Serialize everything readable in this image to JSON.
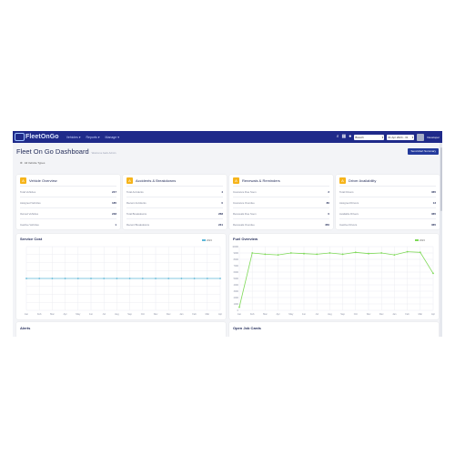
{
  "navbar": {
    "logo_text": "FleetOnGo",
    "menu": [
      {
        "label": "Vehicles"
      },
      {
        "label": "Reports"
      },
      {
        "label": "Manage"
      }
    ],
    "branch_select": "Branch",
    "period_select": "01 Apr 2024 - 31",
    "user_name": "Developer"
  },
  "page": {
    "title": "Fleet On Go Dashboard",
    "subtitle": "Welcome back Admin",
    "primary_button": "Send Alert Summary",
    "filter_label": "All Vehicle Types"
  },
  "cards": [
    {
      "icon": "A",
      "title": "Vehicle Overview",
      "rows": [
        {
          "label": "Total Vehicles",
          "value": "247"
        },
        {
          "label": "Assigned Vehicles",
          "value": "185"
        },
        {
          "label": "Owned Vehicles",
          "value": "248"
        },
        {
          "label": "Inactive Vehicles",
          "value": "1"
        }
      ]
    },
    {
      "icon": "A",
      "title": "Accidents & Breakdowns",
      "rows": [
        {
          "label": "Total Accidents",
          "value": "4"
        },
        {
          "label": "Recent Accidents",
          "value": "0"
        },
        {
          "label": "Total Breakdowns",
          "value": "268"
        },
        {
          "label": "Recent Breakdowns",
          "value": "231"
        }
      ]
    },
    {
      "icon": "A",
      "title": "Renewals & Reminders",
      "rows": [
        {
          "label": "Insurance Due Soon",
          "value": "2"
        },
        {
          "label": "Insurance Overdue",
          "value": "80"
        },
        {
          "label": "Renewals Due Soon",
          "value": "0"
        },
        {
          "label": "Renewals Overdue",
          "value": "450"
        }
      ]
    },
    {
      "icon": "A",
      "title": "Driver Availability",
      "rows": [
        {
          "label": "Total Drivers",
          "value": "365"
        },
        {
          "label": "Assigned Drivers",
          "value": "13"
        },
        {
          "label": "Available Drivers",
          "value": "365"
        },
        {
          "label": "Inactive Drivers",
          "value": "365"
        }
      ]
    }
  ],
  "charts": {
    "service_cost": {
      "title": "Service Cost"
    },
    "fuel_overview": {
      "title": "Fuel Overview"
    }
  },
  "bottom": {
    "alerts": "Alerts",
    "open_jobs": "Open Job Cards"
  },
  "colors": {
    "navbar": "#1f2a8a",
    "accent": "#f6b41a",
    "service_line": "#5fb8d8",
    "fuel_line": "#7ed957"
  },
  "chart_data": [
    {
      "type": "line",
      "title": "Service Cost",
      "categories": [
        "Jan",
        "Feb",
        "Mar",
        "Apr",
        "May",
        "Jun",
        "Jul",
        "Aug",
        "Sep",
        "Oct",
        "Nov",
        "Dec",
        "Jan",
        "Feb",
        "Mar",
        "Apr"
      ],
      "legend": "2023",
      "series": [
        {
          "name": "2023",
          "values": [
            0,
            0,
            0,
            0,
            0,
            0,
            0,
            0,
            0,
            0,
            0,
            0,
            0,
            0,
            0,
            0
          ]
        }
      ],
      "ylim": [
        -1,
        1
      ],
      "grid": true,
      "legend_position": "top-right"
    },
    {
      "type": "line",
      "title": "Fuel Overview",
      "categories": [
        "Jan",
        "Feb",
        "Mar",
        "Apr",
        "May",
        "Jun",
        "Jul",
        "Aug",
        "Sep",
        "Oct",
        "Nov",
        "Dec",
        "Jan",
        "Feb",
        "Mar",
        "Apr"
      ],
      "legend": "2023",
      "series": [
        {
          "name": "2023",
          "values": [
            500,
            9000,
            8800,
            8700,
            9000,
            8900,
            8800,
            9000,
            8800,
            9100,
            8900,
            9000,
            8700,
            9200,
            9100,
            5800
          ]
        }
      ],
      "ylim": [
        0,
        10000
      ],
      "y_ticks": [
        "10000",
        "9000",
        "8000",
        "7000",
        "6000",
        "5000",
        "4000",
        "3000",
        "2000",
        "1000",
        "0"
      ],
      "grid": true,
      "legend_position": "top-right"
    }
  ]
}
